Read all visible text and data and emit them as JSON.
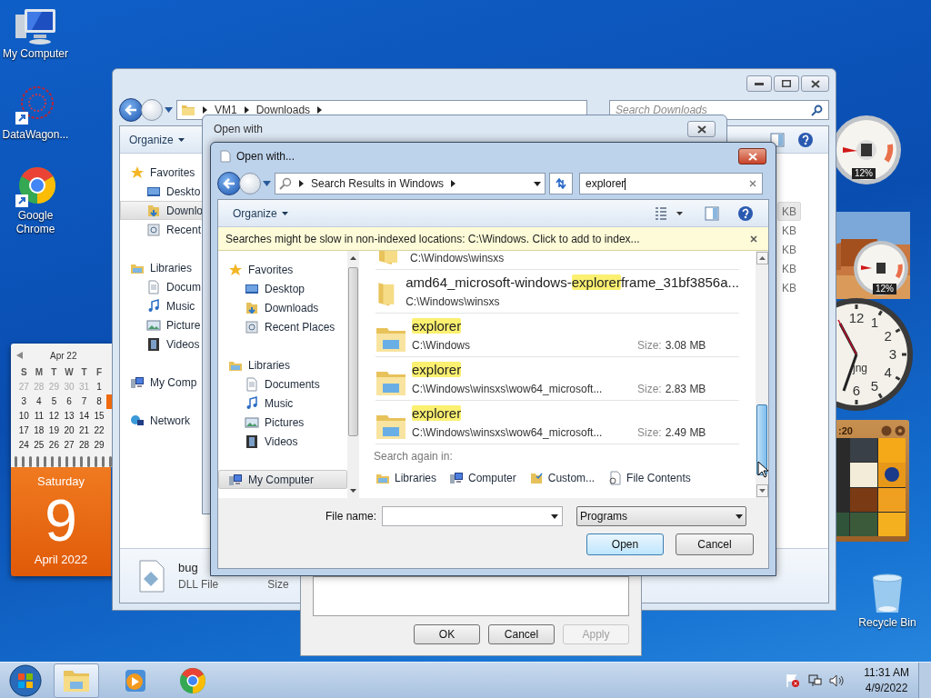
{
  "desktop_icons": [
    {
      "label": "My Computer",
      "kind": "computer"
    },
    {
      "label": "DataWagon...",
      "kind": "datawagon"
    },
    {
      "label": "Google Chrome",
      "kind": "chrome"
    }
  ],
  "recycle_bin": {
    "label": "Recycle Bin"
  },
  "calendar": {
    "month": "Apr 22",
    "weekdays": [
      "S",
      "M",
      "T",
      "W",
      "T",
      "F"
    ],
    "weeks": [
      {
        "has_today": false,
        "days": [
          {
            "d": "27",
            "other": true
          },
          {
            "d": "28",
            "other": true
          },
          {
            "d": "29",
            "other": true
          },
          {
            "d": "30",
            "other": true
          },
          {
            "d": "31",
            "other": true
          },
          {
            "d": "1",
            "other": false
          }
        ]
      },
      {
        "has_today": true,
        "days": [
          {
            "d": "3",
            "other": false
          },
          {
            "d": "4",
            "other": false
          },
          {
            "d": "5",
            "other": false
          },
          {
            "d": "6",
            "other": false
          },
          {
            "d": "7",
            "other": false
          },
          {
            "d": "8",
            "other": false
          }
        ]
      },
      {
        "has_today": false,
        "days": [
          {
            "d": "10",
            "other": false
          },
          {
            "d": "11",
            "other": false
          },
          {
            "d": "12",
            "other": false
          },
          {
            "d": "13",
            "other": false
          },
          {
            "d": "14",
            "other": false
          },
          {
            "d": "15",
            "other": false
          }
        ]
      },
      {
        "has_today": false,
        "days": [
          {
            "d": "17",
            "other": false
          },
          {
            "d": "18",
            "other": false
          },
          {
            "d": "19",
            "other": false
          },
          {
            "d": "20",
            "other": false
          },
          {
            "d": "21",
            "other": false
          },
          {
            "d": "22",
            "other": false
          }
        ]
      },
      {
        "has_today": false,
        "days": [
          {
            "d": "24",
            "other": false
          },
          {
            "d": "25",
            "other": false
          },
          {
            "d": "26",
            "other": false
          },
          {
            "d": "27",
            "other": false
          },
          {
            "d": "28",
            "other": false
          },
          {
            "d": "29",
            "other": false
          }
        ]
      }
    ],
    "weekday": "Saturday",
    "day": "9",
    "month_year": "April 2022"
  },
  "gadgets": {
    "cpu_reading": "12%",
    "slideshow_reading": "12%",
    "clock_numerals": [
      "12",
      "1",
      "2",
      "3",
      "4",
      "5",
      "6"
    ],
    "clock_label": "jng",
    "puzzle_timer": ":20"
  },
  "explorer": {
    "address": [
      "VM1",
      "Downloads"
    ],
    "search_placeholder": "Search Downloads",
    "organize": "Organize",
    "nav": [
      {
        "label": "Favorites",
        "kind": "favorites",
        "selected": false,
        "children": [
          {
            "label": "Deskto",
            "kind": "desktop",
            "selected": false
          },
          {
            "label": "Downlo",
            "kind": "downloads",
            "selected": true
          },
          {
            "label": "Recent",
            "kind": "recent",
            "selected": false
          }
        ]
      },
      {
        "label": "Libraries",
        "kind": "libraries",
        "selected": false,
        "children": [
          {
            "label": "Docum",
            "kind": "documents",
            "selected": false
          },
          {
            "label": "Music",
            "kind": "music",
            "selected": false
          },
          {
            "label": "Picture",
            "kind": "pictures",
            "selected": false
          },
          {
            "label": "Videos",
            "kind": "videos",
            "selected": false
          }
        ]
      },
      {
        "label": "My Comp",
        "kind": "computer",
        "selected": false
      },
      {
        "label": "Network",
        "kind": "network",
        "selected": false
      }
    ],
    "sizes": [
      {
        "text": "KB",
        "selected": true
      },
      {
        "text": "KB",
        "selected": false
      },
      {
        "text": "KB",
        "selected": false
      },
      {
        "text": "KB",
        "selected": false
      },
      {
        "text": "KB",
        "selected": false
      }
    ],
    "details": {
      "name": "bug",
      "type": "DLL File",
      "size_label": "Size"
    }
  },
  "open_with_back": {
    "title": "Open with"
  },
  "properties": {
    "buttons": [
      {
        "label": "OK",
        "disabled": false
      },
      {
        "label": "Cancel",
        "disabled": false
      },
      {
        "label": "Apply",
        "disabled": true
      }
    ]
  },
  "dialog": {
    "title": "Open with...",
    "address": "Search Results in Windows",
    "search_value": "explorer",
    "organize": "Organize",
    "infobar": "Searches might be slow in non-indexed locations: C:\\Windows. Click to add to index...",
    "nav": [
      {
        "label": "Favorites",
        "kind": "favorites",
        "selected": false,
        "children": [
          {
            "label": "Desktop",
            "kind": "desktop",
            "selected": false
          },
          {
            "label": "Downloads",
            "kind": "downloads",
            "selected": false
          },
          {
            "label": "Recent Places",
            "kind": "recent",
            "selected": false
          }
        ]
      },
      {
        "label": "Libraries",
        "kind": "libraries",
        "selected": false,
        "children": [
          {
            "label": "Documents",
            "kind": "documents",
            "selected": false
          },
          {
            "label": "Music",
            "kind": "music",
            "selected": false
          },
          {
            "label": "Pictures",
            "kind": "pictures",
            "selected": false
          },
          {
            "label": "Videos",
            "kind": "videos",
            "selected": false
          }
        ]
      },
      {
        "label": "My Computer",
        "kind": "computer",
        "selected": true
      }
    ],
    "results": [
      {
        "kind": "folder",
        "path": "C:\\Windows\\winsxs"
      },
      {
        "kind": "folder",
        "name": [
          {
            "text": "amd64_microsoft-windows-",
            "highlight": false
          },
          {
            "text": "explorer",
            "highlight": true
          },
          {
            "text": "frame_31bf3856a...",
            "highlight": false
          }
        ],
        "path": "C:\\Windows\\winsxs"
      },
      {
        "kind": "program",
        "name": [
          {
            "text": "explorer",
            "highlight": true
          }
        ],
        "path": "C:\\Windows",
        "size_label": "Size:",
        "size": "3.08 MB"
      },
      {
        "kind": "program",
        "name": [
          {
            "text": "explorer",
            "highlight": true
          }
        ],
        "path": "C:\\Windows\\winsxs\\wow64_microsoft...",
        "size_label": "Size:",
        "size": "2.83 MB"
      },
      {
        "kind": "program",
        "name": [
          {
            "text": "explorer",
            "highlight": true
          }
        ],
        "path": "C:\\Windows\\winsxs\\wow64_microsoft...",
        "size_label": "Size:",
        "size": "2.49 MB"
      }
    ],
    "search_again_label": "Search again in:",
    "search_again": [
      {
        "label": "Libraries",
        "kind": "libraries"
      },
      {
        "label": "Computer",
        "kind": "computer"
      },
      {
        "label": "Custom...",
        "kind": "custom"
      },
      {
        "label": "File Contents",
        "kind": "contents"
      }
    ],
    "file_name_label": "File name:",
    "filter": "Programs",
    "open": "Open",
    "cancel": "Cancel"
  },
  "taskbar": {
    "items": [
      {
        "kind": "explorer",
        "active": true
      },
      {
        "kind": "media",
        "active": false
      },
      {
        "kind": "chrome",
        "active": false
      }
    ],
    "time": "11:31 AM",
    "date": "4/9/2022"
  }
}
